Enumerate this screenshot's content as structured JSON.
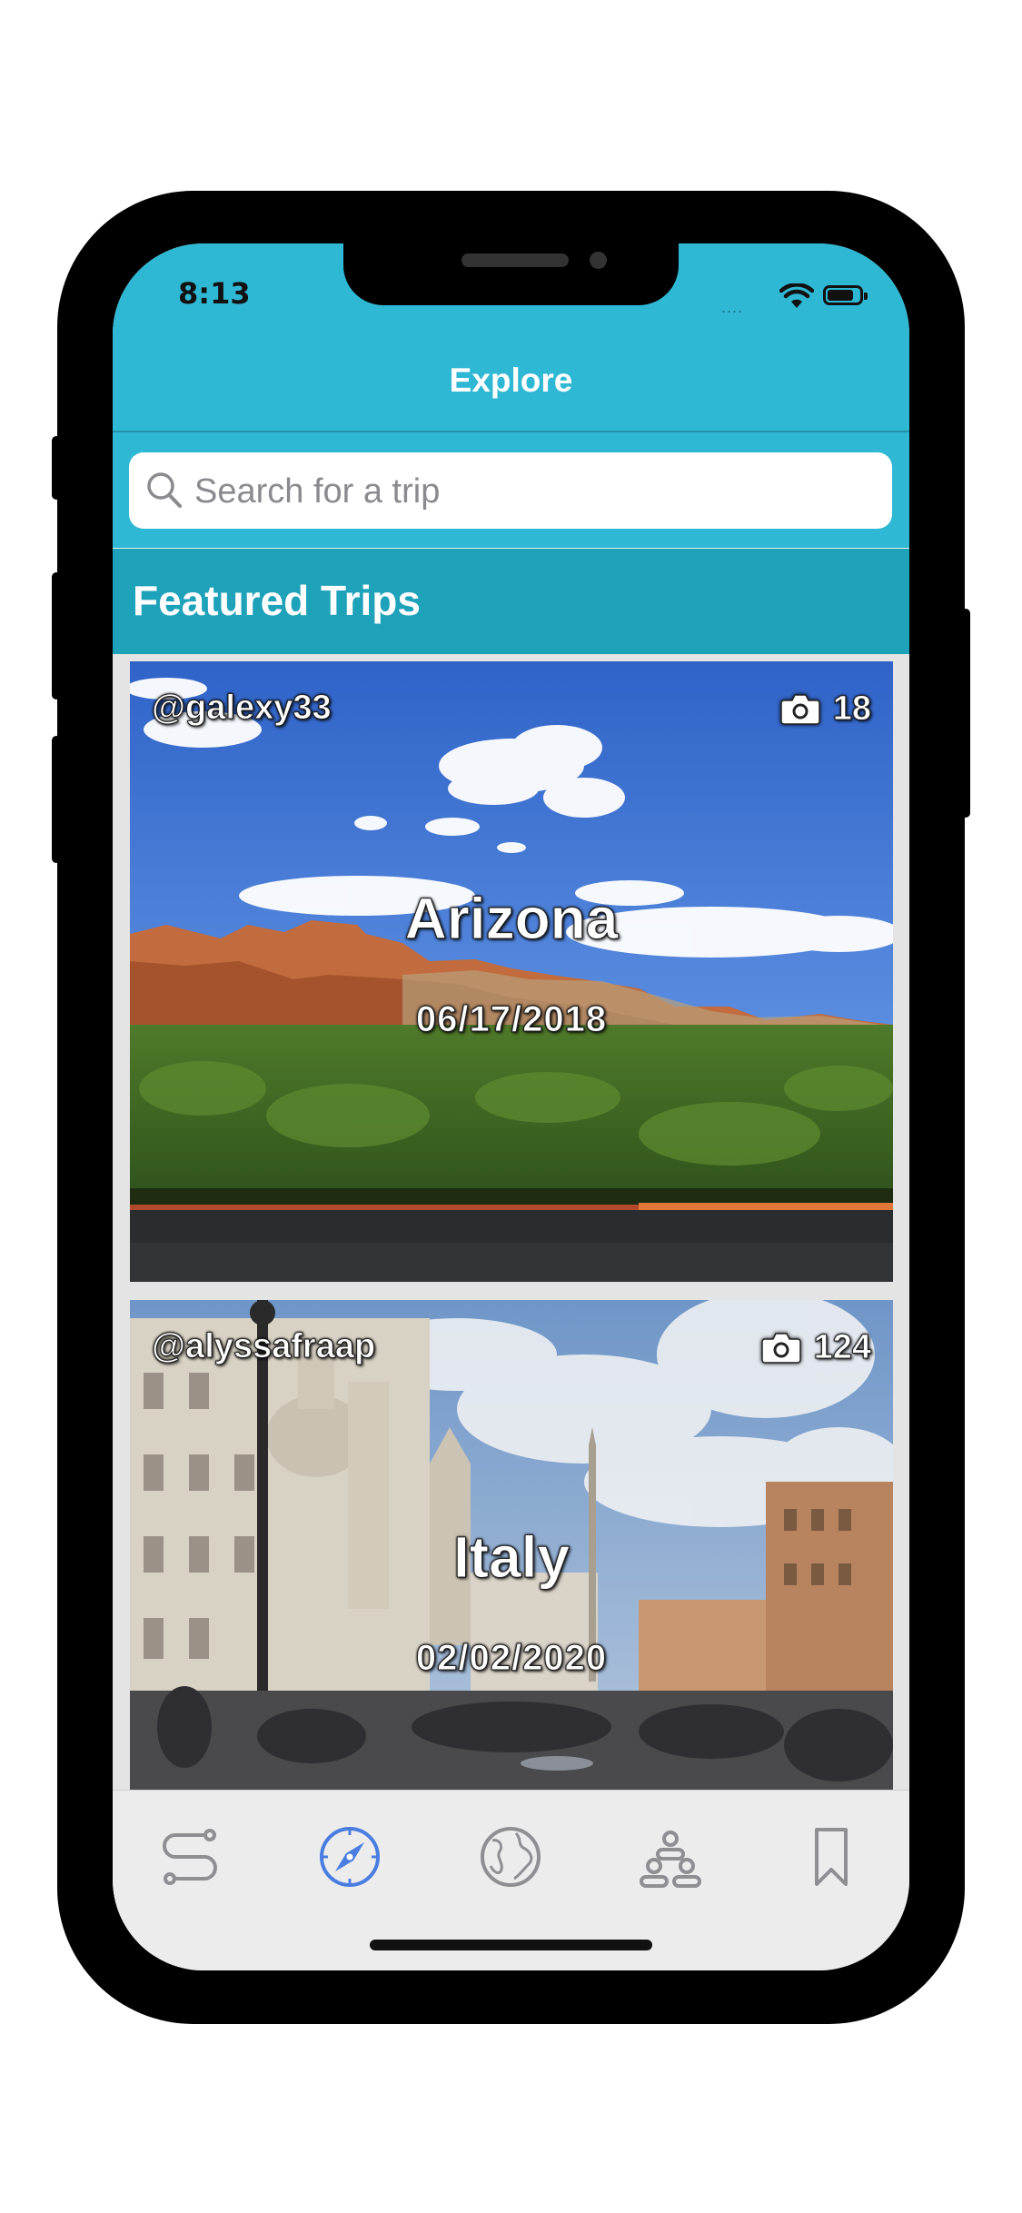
{
  "status_bar": {
    "time": "8:13",
    "signal": "....",
    "wifi_icon": "wifi-icon",
    "battery_icon": "battery-icon"
  },
  "header": {
    "title": "Explore"
  },
  "search": {
    "placeholder": "Search for a trip",
    "value": "",
    "icon": "search-icon"
  },
  "section": {
    "title": "Featured Trips"
  },
  "trips": [
    {
      "user": "@galexy33",
      "photo_count": "18",
      "title": "Arizona",
      "date": "06/17/2018"
    },
    {
      "user": "@alyssafraap",
      "photo_count": "124",
      "title": "Italy",
      "date": "02/02/2020"
    }
  ],
  "tabbar": {
    "active_index": 1,
    "active_color": "#4a7de0",
    "inactive_color": "#8e8e93",
    "tabs": [
      {
        "icon": "route-icon"
      },
      {
        "icon": "compass-icon"
      },
      {
        "icon": "globe-icon"
      },
      {
        "icon": "community-icon"
      },
      {
        "icon": "bookmark-icon"
      }
    ]
  },
  "colors": {
    "header": "#2fb8d4",
    "section_bar": "#1ea2ba"
  }
}
